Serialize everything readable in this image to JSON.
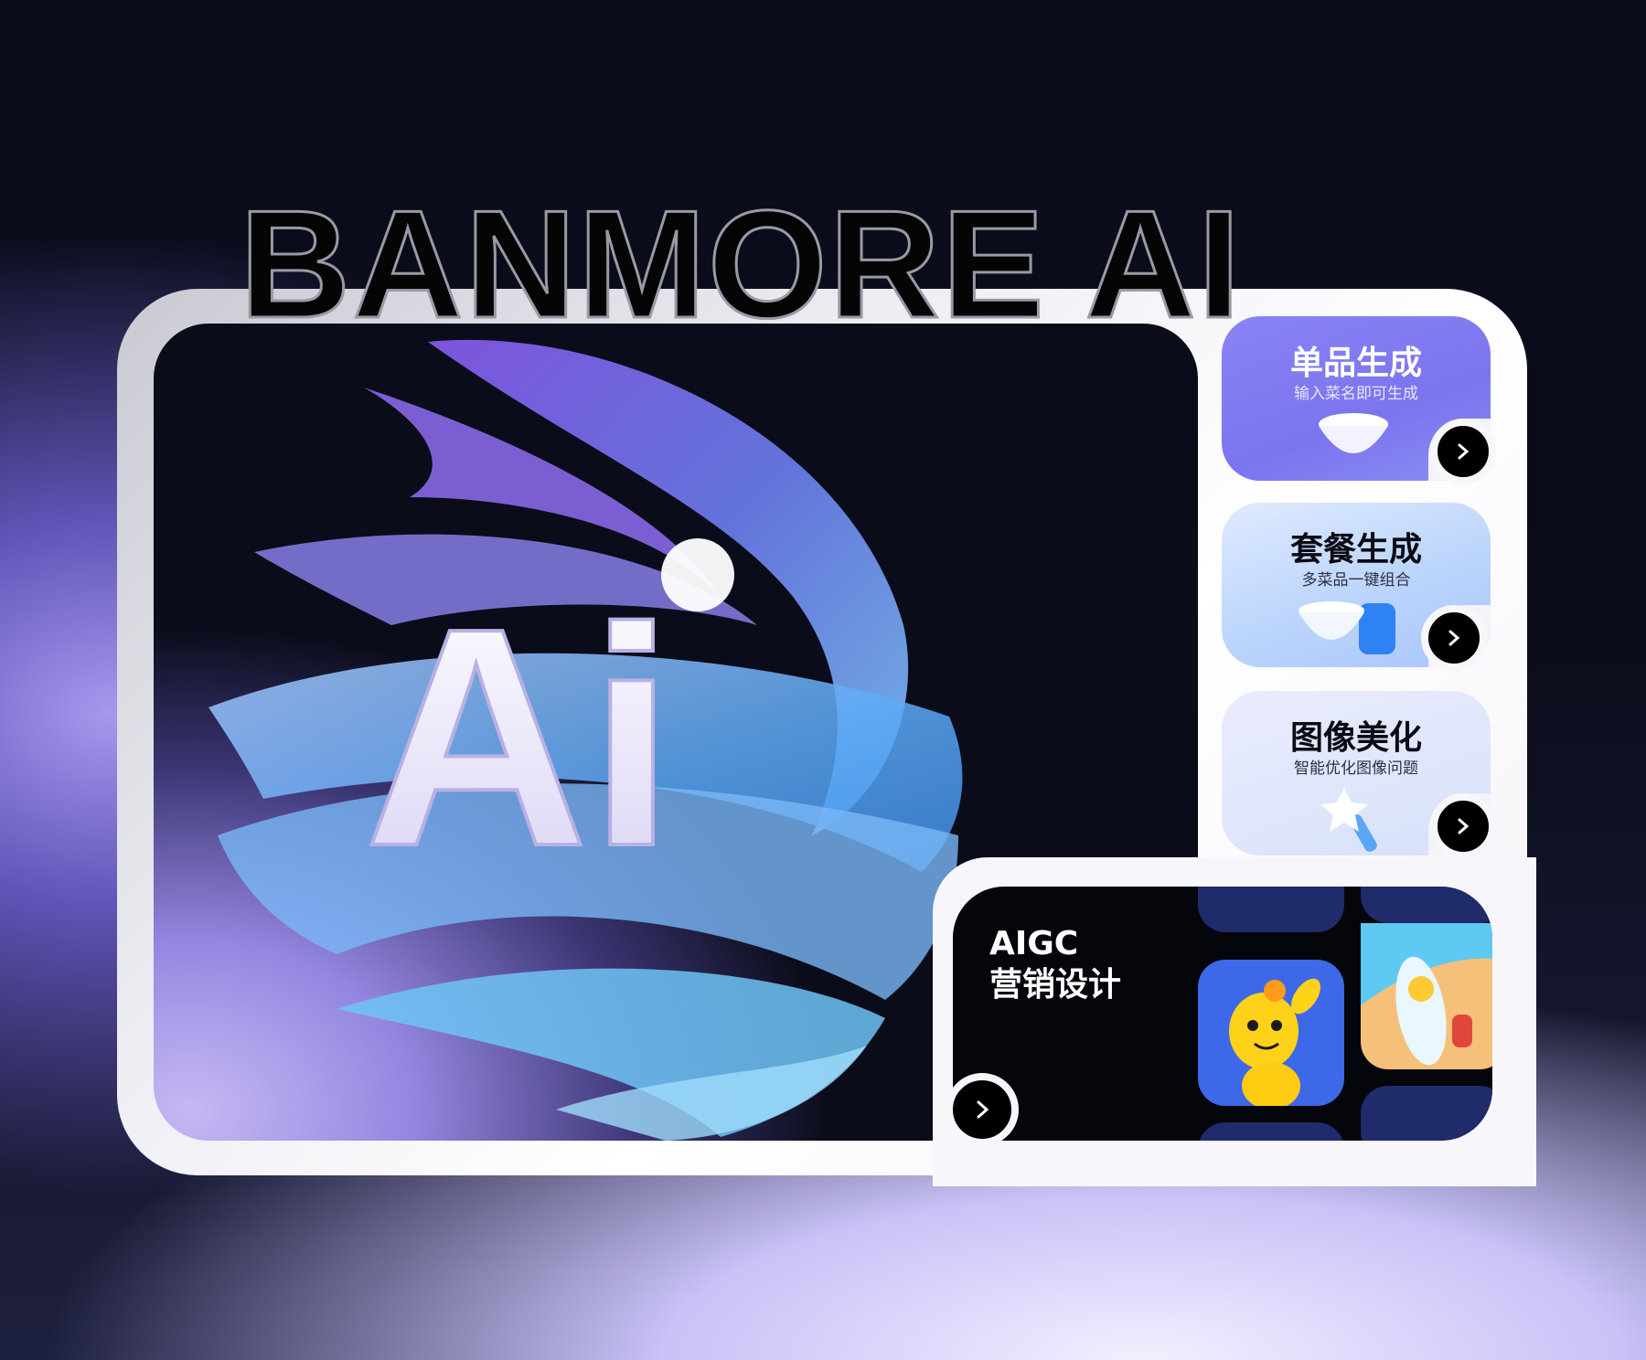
{
  "brand": {
    "title": "BANMORE AI"
  },
  "hero": {
    "logo_text": "Ai"
  },
  "cards": [
    {
      "title": "单品生成",
      "subtitle": "输入菜名即可生成",
      "icon": "bowl-icon"
    },
    {
      "title": "套餐生成",
      "subtitle": "多菜品一键组合",
      "icon": "bowl-and-cup-icon"
    },
    {
      "title": "图像美化",
      "subtitle": "智能优化图像问题",
      "icon": "magic-wand-icon"
    }
  ],
  "aigc": {
    "line1": "AIGC",
    "line2": "营销设计"
  },
  "colors": {
    "accent_purple": "#7f73f0",
    "accent_blue": "#a9c6fb",
    "dark": "#05060b"
  }
}
